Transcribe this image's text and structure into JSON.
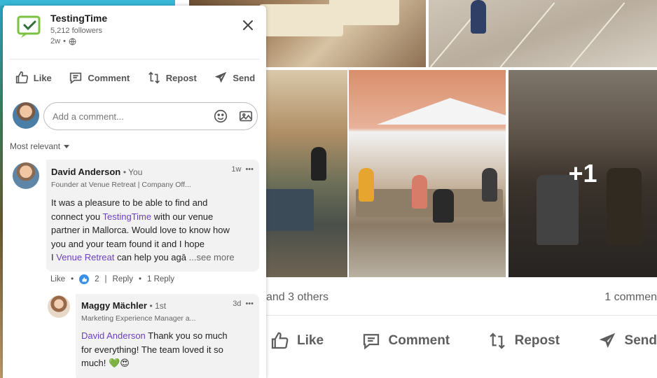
{
  "post": {
    "company_name": "TestingTime",
    "followers": "5,212 followers",
    "age": "2w",
    "more_images": "+1",
    "social_proof": "and 3 others",
    "comment_count": "1 commen",
    "actions": {
      "like": "Like",
      "comment": "Comment",
      "repost": "Repost",
      "send": "Send"
    }
  },
  "composer": {
    "placeholder": "Add a comment..."
  },
  "sort": {
    "label": "Most relevant"
  },
  "comments": [
    {
      "author": "David Anderson",
      "relation": "• You",
      "headline": "Founder at Venue Retreat | Company Off...",
      "time": "1w",
      "text_lines": [
        "It was a pleasure to be able to find and",
        "connect you ",
        "TestingTime",
        " with our venue",
        "partner in Mallorca. Would love to know how",
        "you and your team found it and I hope",
        "I ",
        "Venue Retreat",
        " can help you agā",
        "...see more"
      ],
      "like_label": "Like",
      "like_count": "2",
      "reply_label": "Reply",
      "replies": "1 Reply"
    },
    {
      "author": "Maggy Mächler",
      "relation": "• 1st",
      "headline": "Marketing Experience Manager a...",
      "time": "3d",
      "mention": "David Anderson",
      "text_line1": " Thank you so much",
      "text_line2": "for everything! The team loved it so",
      "text_line3": "much! ",
      "emojis": "💚😍"
    }
  ],
  "colors": {
    "accent_mention": "#6b3fbf",
    "logo_green": "#7cc242",
    "like_blue": "#378fe9"
  },
  "icons": [
    "logo-icon",
    "globe-icon",
    "close-icon",
    "like-icon",
    "comment-icon",
    "repost-icon",
    "send-icon",
    "emoji-icon",
    "image-icon",
    "more-icon"
  ]
}
